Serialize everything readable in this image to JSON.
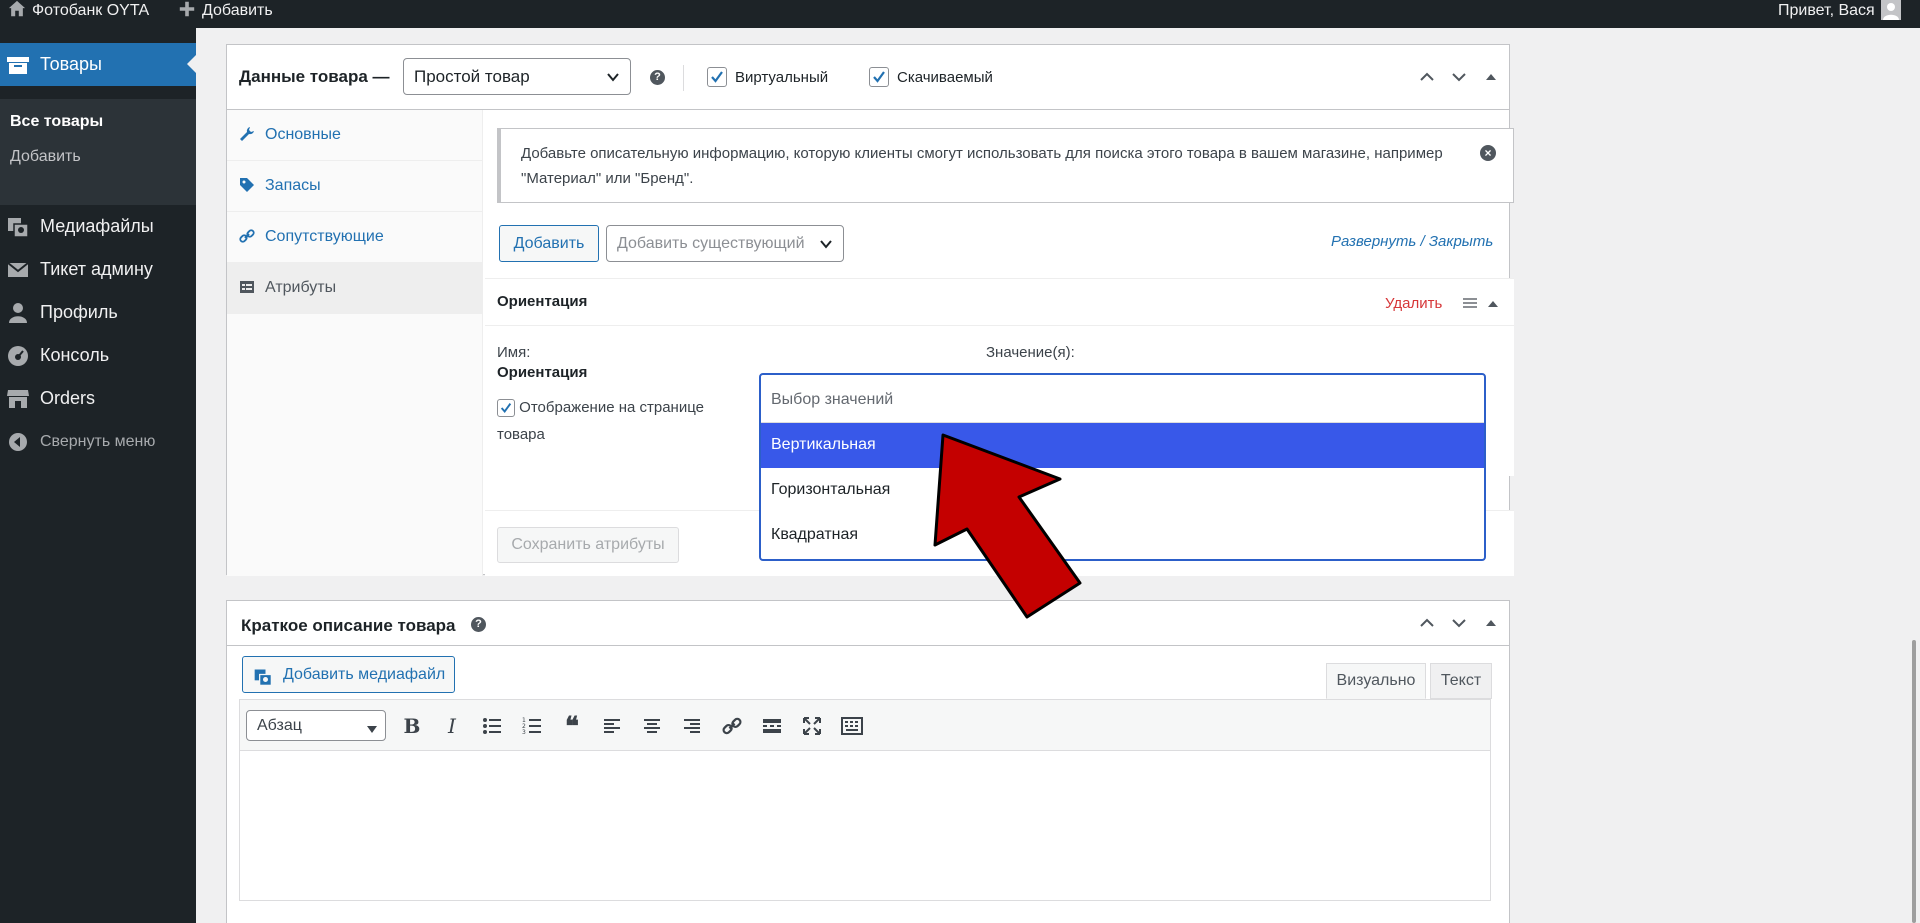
{
  "adminbar": {
    "site_name": "Фотобанк OYTA",
    "add_new": "Добавить",
    "greeting": "Привет, Вася"
  },
  "sidebar": {
    "products": "Товары",
    "sub_all": "Все товары",
    "sub_add": "Добавить",
    "media": "Медиафайлы",
    "ticket": "Тикет админу",
    "profile": "Профиль",
    "console": "Консоль",
    "orders": "Orders",
    "collapse": "Свернуть меню"
  },
  "product_data": {
    "title": "Данные товара —",
    "type_selected": "Простой товар",
    "virtual_label": "Виртуальный",
    "downloadable_label": "Скачиваемый",
    "virtual_checked": true,
    "downloadable_checked": true,
    "tabs": [
      {
        "label": "Основные",
        "icon": "wrench-icon"
      },
      {
        "label": "Запасы",
        "icon": "tag-icon"
      },
      {
        "label": "Сопутствующие",
        "icon": "link-icon"
      },
      {
        "label": "Атрибуты",
        "icon": "list-view-icon"
      }
    ],
    "active_tab": "Атрибуты"
  },
  "attributes": {
    "notice": "Добавьте описательную информацию, которую клиенты смогут использовать для поиска этого товара в вашем магазине, например \"Материал\" или \"Бренд\".",
    "add_button": "Добавить",
    "add_existing_placeholder": "Добавить существующий",
    "expand_collapse": "Развернуть / Закрыть",
    "attribute_title": "Ориентация",
    "remove_link": "Удалить",
    "name_label": "Имя:",
    "name_value": "Ориентация",
    "values_label": "Значение(я):",
    "visible_on_page_label": "Отображение на странице товара",
    "visible_checked": true,
    "save_button": "Сохранить атрибуты",
    "values_placeholder": "Выбор значений",
    "options": [
      "Вертикальная",
      "Горизонтальная",
      "Квадратная"
    ],
    "highlighted_option": "Вертикальная"
  },
  "short_description": {
    "title": "Краткое описание товара",
    "add_media": "Добавить медиафайл",
    "tab_visual": "Визуально",
    "tab_text": "Текст",
    "format_select": "Абзац"
  },
  "colors": {
    "admin_dark": "#1d2327",
    "accent": "#2271b1",
    "highlight": "#3858e9",
    "delete": "#d63638",
    "arrow": "#c40000"
  }
}
